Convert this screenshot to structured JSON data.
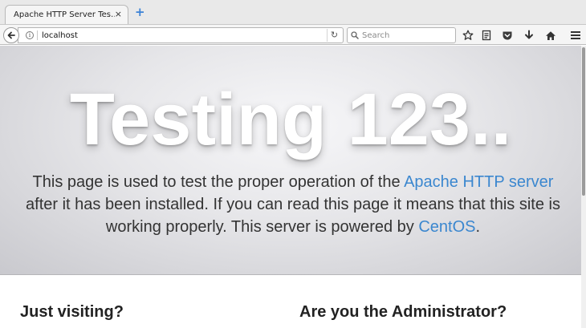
{
  "browser": {
    "tab_title": "Apache HTTP Server Tes…",
    "tab_close": "×",
    "new_tab": "+",
    "url": "localhost",
    "search_placeholder": "Search",
    "icons": [
      "back-arrow-icon",
      "info-icon",
      "reload-icon",
      "search-icon",
      "bookmark-star-icon",
      "reading-list-icon",
      "pocket-icon",
      "download-icon",
      "home-icon",
      "menu-icon"
    ]
  },
  "hero": {
    "title": "Testing 123..",
    "text_before_link1": "This page is used to test the proper operation of the ",
    "link1": "Apache HTTP server",
    "text_middle": " after it has been installed. If you can read this page it means that this site is working properly. This server is powered by ",
    "link2": "CentOS",
    "text_end": "."
  },
  "sections": {
    "left_heading": "Just visiting?",
    "right_heading": "Are you the Administrator?"
  },
  "colors": {
    "link": "#3b87cf",
    "new_tab": "#3b82d6"
  }
}
